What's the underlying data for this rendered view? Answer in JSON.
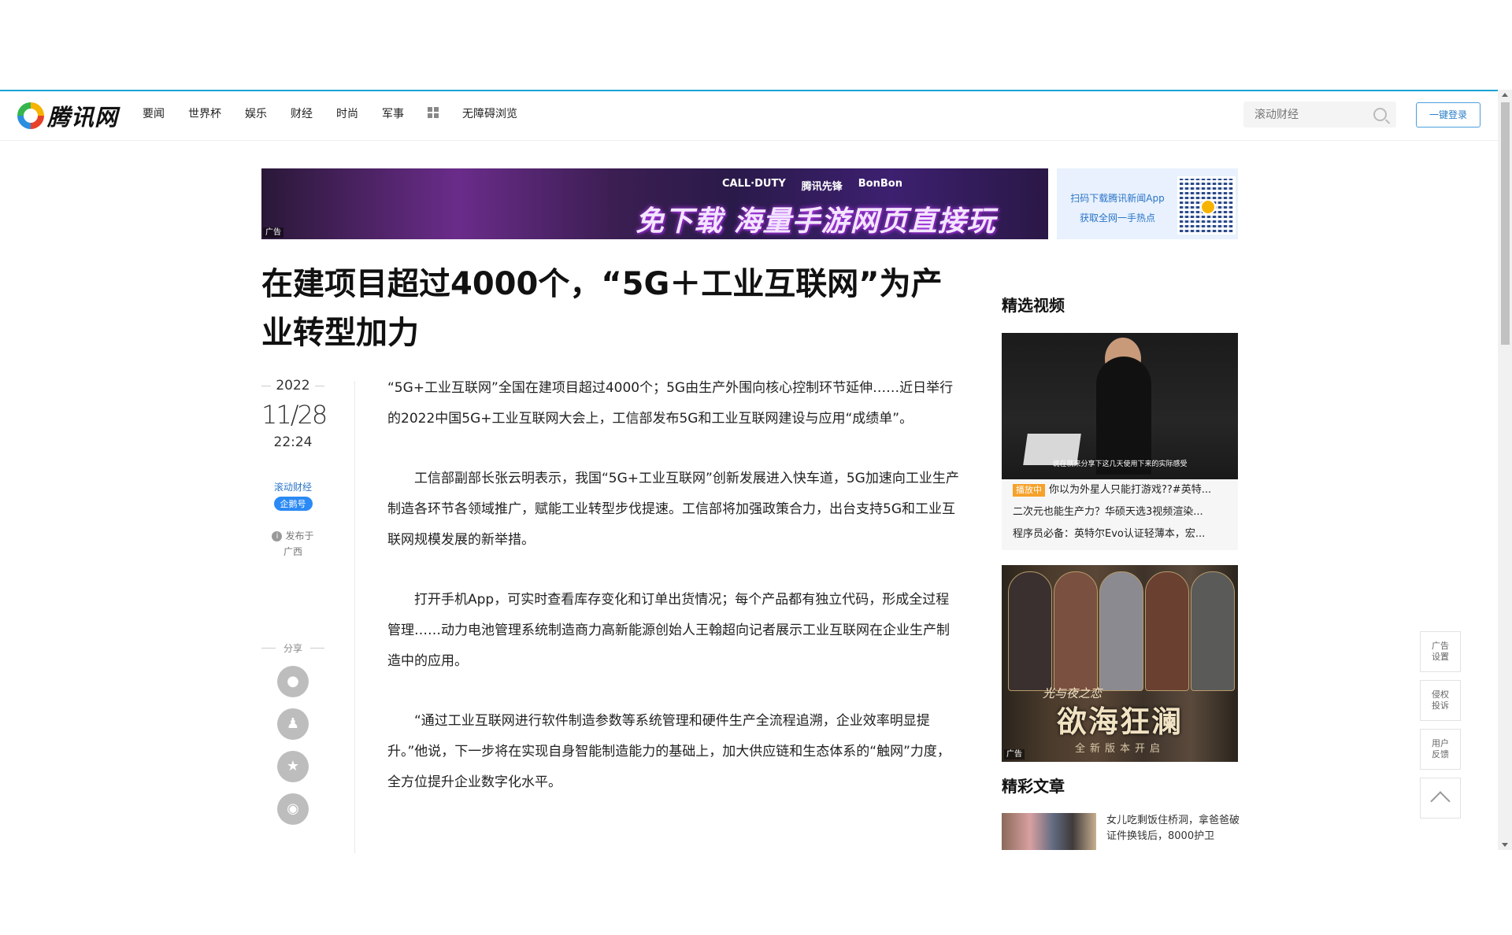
{
  "nav": {
    "logo_text": "腾讯网",
    "items": [
      "要闻",
      "世界杯",
      "娱乐",
      "财经",
      "时尚",
      "军事"
    ],
    "accessible": "无障碍浏览",
    "search_placeholder": "滚动财经",
    "login": "一键登录"
  },
  "banner": {
    "logos": [
      "CALL·DUTY",
      "腾讯先锋",
      "BonBon"
    ],
    "slogan": "免下载 海量手游网页直接玩",
    "ad_label": "广告",
    "qr_line1": "扫码下载腾讯新闻App",
    "qr_line2": "获取全网一手热点"
  },
  "article": {
    "title": "在建项目超过4000个，“5G＋工业互联网”为产业转型加力",
    "year": "2022",
    "date": "11/28",
    "time": "22:24",
    "source": "滚动财经",
    "badge": "企鹅号",
    "published_label": "发布于",
    "location": "广西",
    "share_label": "分享",
    "paragraphs": [
      "“5G+工业互联网”全国在建项目超过4000个；5G由生产外围向核心控制环节延伸……近日举行的2022中国5G+工业互联网大会上，工信部发布5G和工业互联网建设与应用“成绩单”。",
      "工信部副部长张云明表示，我国“5G+工业互联网”创新发展进入快车道，5G加速向工业生产制造各环节各领域推广，赋能工业转型步伐提速。工信部将加强政策合力，出台支持5G和工业互联网规模发展的新举措。",
      "打开手机App，可实时查看库存变化和订单出货情况；每个产品都有独立代码，形成全过程管理……动力电池管理系统制造商力高新能源创始人王翰超向记者展示工业互联网在企业生产制造中的应用。",
      "“通过工业互联网进行软件制造参数等系统管理和硬件生产全流程追溯，企业效率明显提升。”他说，下一步将在实现自身智能制造能力的基础上，加大供应链和生态体系的“触网”力度，全方位提升企业数字化水平。"
    ]
  },
  "sidebar": {
    "video_title": "精选视频",
    "video_caption": "说在就来分享下这几天使用下来的实际感受",
    "playing_label": "播放中",
    "videos": [
      "你以为外星人只能打游戏??#英特...",
      "二次元也能生产力？华硕天选3视频渲染...",
      "程序员必备：英特尔Evo认证轻薄本，宏..."
    ],
    "game_logo": "光与夜之恋",
    "game_title": "欲海狂澜",
    "game_sub": "全新版本开启",
    "ad_label": "广告",
    "articles_title": "精彩文章",
    "article_snippet": "女儿吃剩饭住桥洞，拿爸爸破证件换钱后，8000护卫"
  },
  "tools": {
    "ad_settings": "广告设置",
    "report": "侵权投诉",
    "feedback": "用户反馈"
  }
}
